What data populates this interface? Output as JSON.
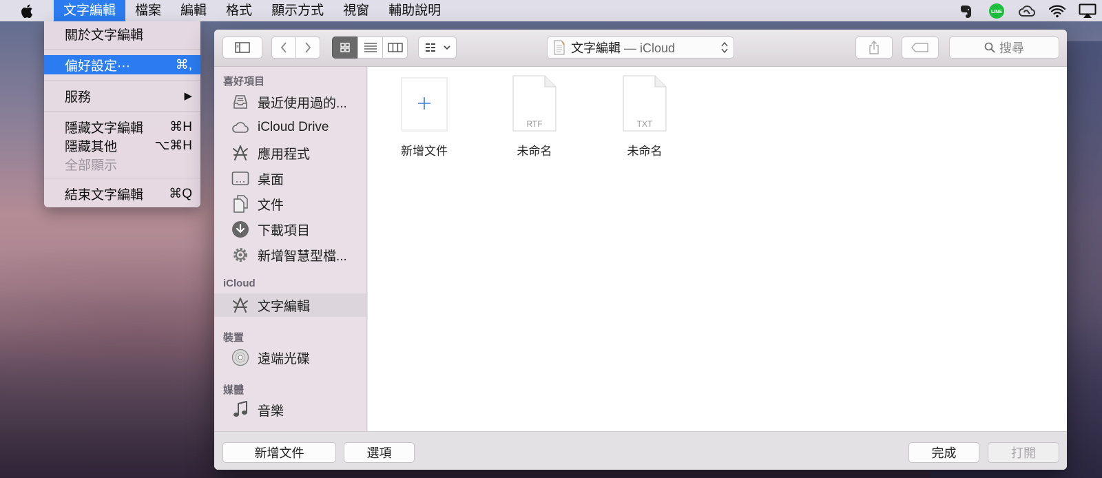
{
  "menubar": {
    "app_menu": "文字編輯",
    "items": [
      "檔案",
      "編輯",
      "格式",
      "顯示方式",
      "視窗",
      "輔助說明"
    ]
  },
  "app_menu": {
    "about": "關於文字編輯",
    "preferences": {
      "label": "偏好設定⋯",
      "shortcut": "⌘,"
    },
    "services": {
      "label": "服務",
      "arrow": "▶"
    },
    "hide": {
      "label": "隱藏文字編輯",
      "shortcut": "⌘H"
    },
    "hide_others": {
      "label": "隱藏其他",
      "shortcut": "⌥⌘H"
    },
    "show_all": "全部顯示",
    "quit": {
      "label": "結束文字編輯",
      "shortcut": "⌘Q"
    }
  },
  "toolbar": {
    "path_title": "文字編輯",
    "path_sub": " — iCloud",
    "search_placeholder": "搜尋"
  },
  "sidebar": {
    "favorites_header": "喜好項目",
    "favorites": [
      {
        "label": "最近使用過的...",
        "icon": "recents-icon"
      },
      {
        "label": "iCloud Drive",
        "icon": "cloud-icon"
      },
      {
        "label": "應用程式",
        "icon": "applications-icon"
      },
      {
        "label": "桌面",
        "icon": "desktop-icon"
      },
      {
        "label": "文件",
        "icon": "documents-icon"
      },
      {
        "label": "下載項目",
        "icon": "downloads-icon"
      },
      {
        "label": "新增智慧型檔...",
        "icon": "gear-icon"
      }
    ],
    "icloud_header": "iCloud",
    "icloud_item": "文字編輯",
    "devices_header": "裝置",
    "devices_item": "遠端光碟",
    "media_header": "媒體",
    "media_item": "音樂"
  },
  "files": [
    {
      "name": "新增文件",
      "kind": "new"
    },
    {
      "name": "未命名",
      "kind": "RTF"
    },
    {
      "name": "未命名",
      "kind": "TXT"
    }
  ],
  "bottom": {
    "new_doc": "新增文件",
    "options": "選項",
    "done": "完成",
    "open": "打開"
  },
  "colors": {
    "accent": "#2b7cf0",
    "line_green": "#1dbf3f"
  }
}
